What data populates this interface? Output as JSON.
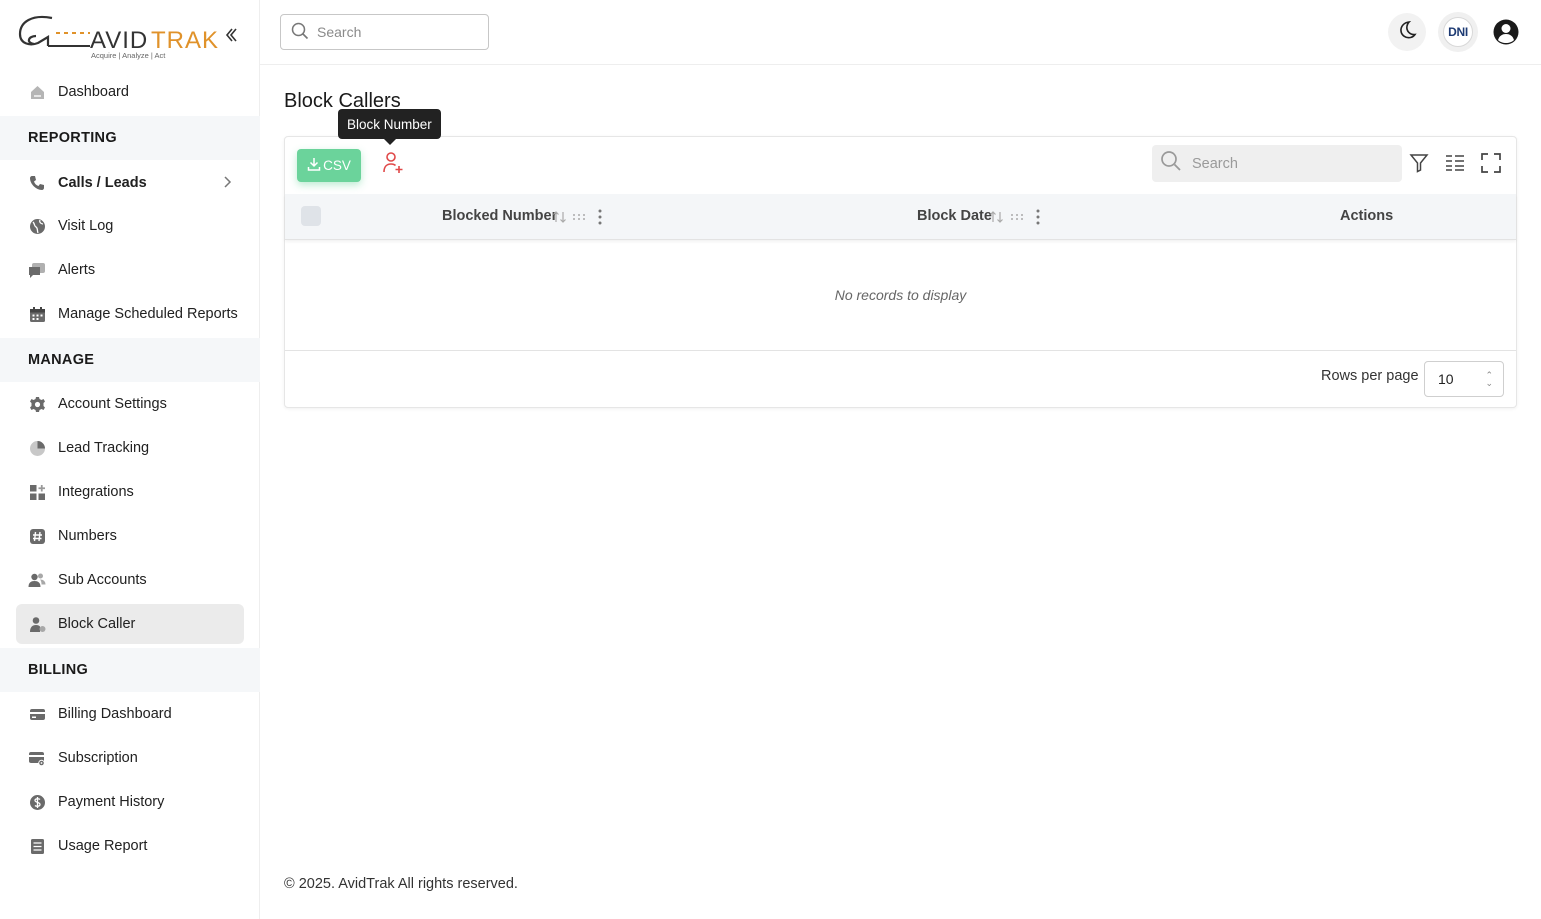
{
  "brand": {
    "name": "AVIDTRAK",
    "tagline": "Acquire | Analyze | Act",
    "accent": "#e0922a"
  },
  "sidebar": {
    "items": [
      {
        "label": "Dashboard",
        "icon": "home-icon"
      },
      {
        "section": "REPORTING"
      },
      {
        "label": "Calls / Leads",
        "icon": "phone-icon"
      },
      {
        "label": "Visit Log",
        "icon": "globe-icon"
      },
      {
        "label": "Alerts",
        "icon": "chat-icon"
      },
      {
        "label": "Manage Scheduled Reports",
        "icon": "calendar-icon"
      },
      {
        "section": "MANAGE"
      },
      {
        "label": "Account Settings",
        "icon": "gear-icon"
      },
      {
        "label": "Lead Tracking",
        "icon": "pie-icon"
      },
      {
        "label": "Integrations",
        "icon": "grid-plus-icon"
      },
      {
        "label": "Numbers",
        "icon": "hash-icon"
      },
      {
        "label": "Sub Accounts",
        "icon": "users-icon"
      },
      {
        "label": "Block Caller",
        "icon": "user-block-icon"
      },
      {
        "section": "BILLING"
      },
      {
        "label": "Billing Dashboard",
        "icon": "card-icon"
      },
      {
        "label": "Subscription",
        "icon": "card-gear-icon"
      },
      {
        "label": "Payment History",
        "icon": "dollar-icon"
      },
      {
        "label": "Usage Report",
        "icon": "list-icon"
      }
    ],
    "labels": {
      "dashboard": "Dashboard",
      "reporting": "REPORTING",
      "calls": "Calls / Leads",
      "visit": "Visit Log",
      "alerts": "Alerts",
      "scheduled": "Manage Scheduled Reports",
      "manage": "MANAGE",
      "account": "Account Settings",
      "lead": "Lead Tracking",
      "integrations": "Integrations",
      "numbers": "Numbers",
      "sub": "Sub Accounts",
      "block": "Block Caller",
      "billing": "BILLING",
      "billing_dash": "Billing Dashboard",
      "subscription": "Subscription",
      "payment": "Payment History",
      "usage": "Usage Report"
    },
    "active": "Block Caller"
  },
  "topbar": {
    "search_placeholder": "Search",
    "dni_label": "DNI"
  },
  "page": {
    "title": "Block Callers",
    "tooltip": "Block Number",
    "csv_label": "CSV",
    "table_search_placeholder": "Search",
    "columns": {
      "blocked_number": "Blocked Number",
      "block_date": "Block Date",
      "actions": "Actions"
    },
    "empty_message": "No records to display",
    "rows_per_page_label": "Rows per page",
    "rows_per_page_value": "10"
  },
  "footer": {
    "text": "© 2025. AvidTrak All rights reserved."
  }
}
